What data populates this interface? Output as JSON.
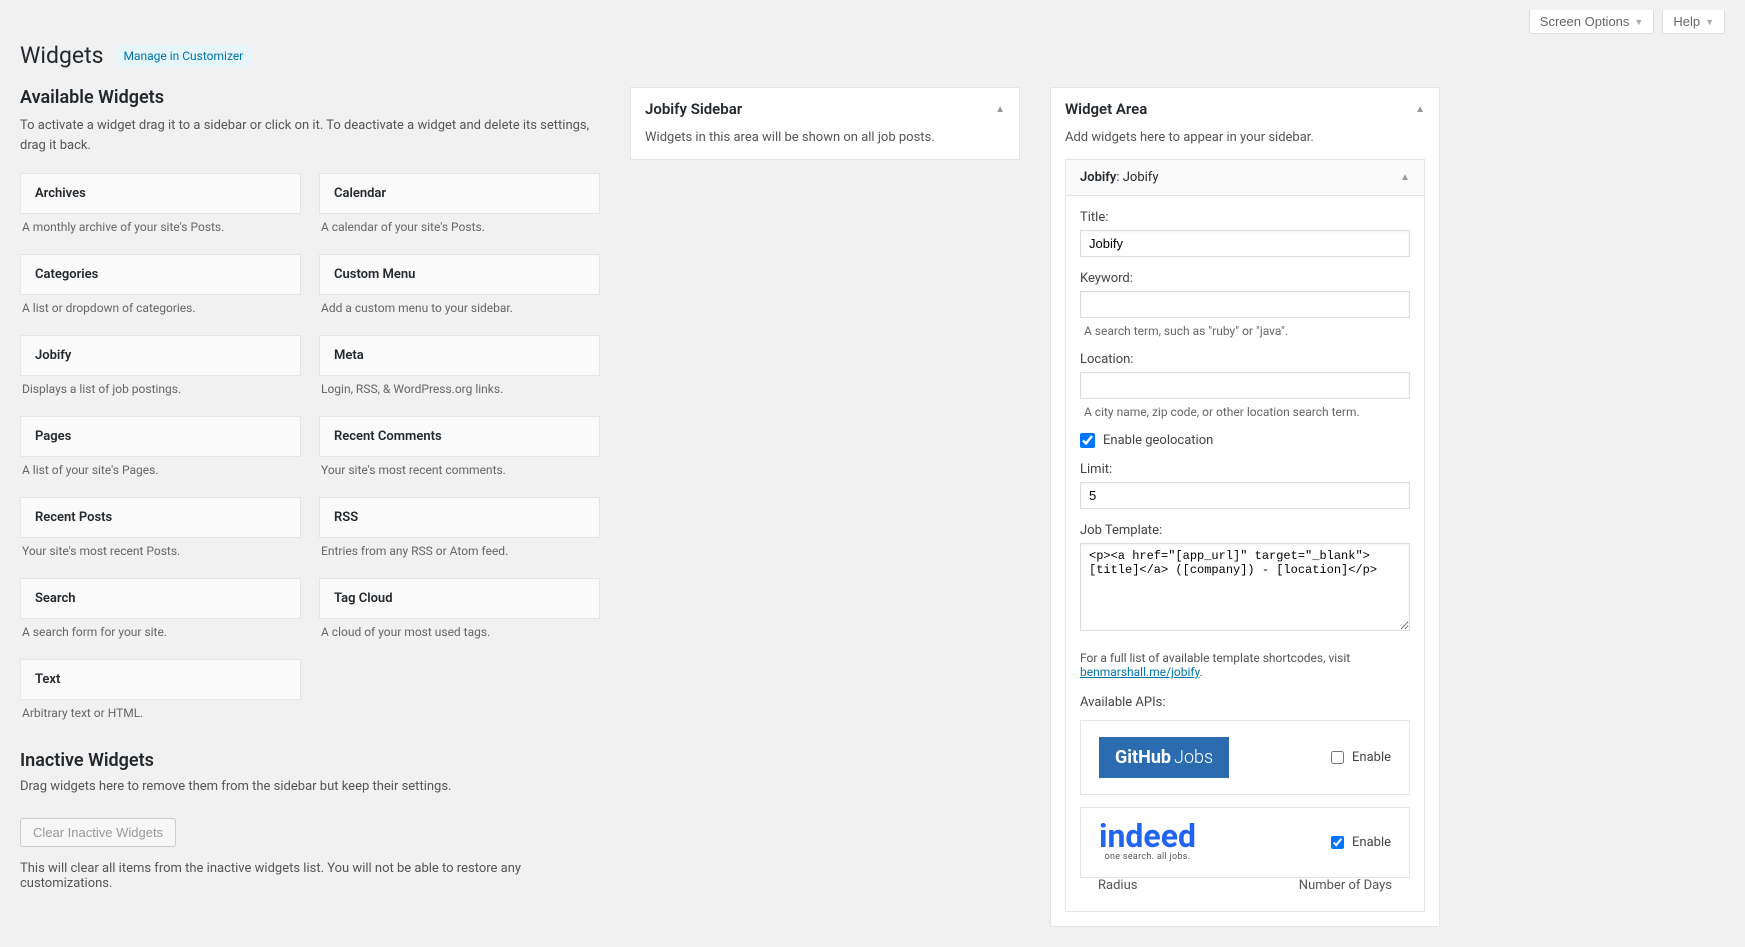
{
  "top": {
    "screen_options": "Screen Options",
    "help": "Help"
  },
  "header": {
    "title": "Widgets",
    "customizer_link": "Manage in Customizer"
  },
  "available": {
    "title": "Available Widgets",
    "desc": "To activate a widget drag it to a sidebar or click on it. To deactivate a widget and delete its settings, drag it back.",
    "widgets": [
      {
        "name": "Archives",
        "desc": "A monthly archive of your site's Posts."
      },
      {
        "name": "Calendar",
        "desc": "A calendar of your site's Posts."
      },
      {
        "name": "Categories",
        "desc": "A list or dropdown of categories."
      },
      {
        "name": "Custom Menu",
        "desc": "Add a custom menu to your sidebar."
      },
      {
        "name": "Jobify",
        "desc": "Displays a list of job postings."
      },
      {
        "name": "Meta",
        "desc": "Login, RSS, & WordPress.org links."
      },
      {
        "name": "Pages",
        "desc": "A list of your site's Pages."
      },
      {
        "name": "Recent Comments",
        "desc": "Your site's most recent comments."
      },
      {
        "name": "Recent Posts",
        "desc": "Your site's most recent Posts."
      },
      {
        "name": "RSS",
        "desc": "Entries from any RSS or Atom feed."
      },
      {
        "name": "Search",
        "desc": "A search form for your site."
      },
      {
        "name": "Tag Cloud",
        "desc": "A cloud of your most used tags."
      },
      {
        "name": "Text",
        "desc": "Arbitrary text or HTML."
      }
    ]
  },
  "inactive": {
    "title": "Inactive Widgets",
    "desc": "Drag widgets here to remove them from the sidebar but keep their settings.",
    "clear_btn": "Clear Inactive Widgets",
    "clear_note": "This will clear all items from the inactive widgets list. You will not be able to restore any customizations."
  },
  "jobify_sidebar": {
    "title": "Jobify Sidebar",
    "desc": "Widgets in this area will be shown on all job posts."
  },
  "widget_area": {
    "title": "Widget Area",
    "desc": "Add widgets here to appear in your sidebar.",
    "subwidget": {
      "prefix": "Jobify",
      "suffix": ": Jobify",
      "fields": {
        "title_label": "Title:",
        "title_value": "Jobify",
        "keyword_label": "Keyword:",
        "keyword_value": "",
        "keyword_hint": "A search term, such as \"ruby\" or \"java\".",
        "location_label": "Location:",
        "location_value": "",
        "location_hint": "A city name, zip code, or other location search term.",
        "geolocation_label": "Enable geolocation",
        "limit_label": "Limit:",
        "limit_value": "5",
        "template_label": "Job Template:",
        "template_value": "<p><a href=\"[app_url]\" target=\"_blank\">[title]</a> ([company]) - [location]</p>",
        "template_note_prefix": "For a full list of available template shortcodes, visit ",
        "template_note_link": "benmarshall.me/jobify",
        "apis_label": "Available APIs:",
        "api_github_brand1": "GitHub",
        "api_github_brand2": "Jobs",
        "api_enable": "Enable",
        "api_indeed_brand": "indeed",
        "api_indeed_tag": "one search. all jobs.",
        "radius_label": "Radius",
        "days_label": "Number of Days"
      }
    }
  }
}
